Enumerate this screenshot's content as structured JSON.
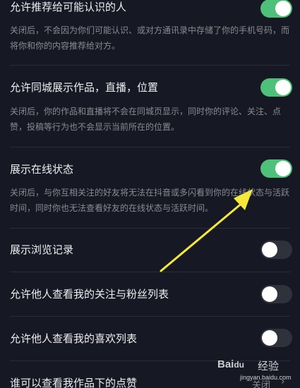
{
  "settings": [
    {
      "title": "允许推荐给可能认识的人",
      "description": "关闭后，不会因为你们可能认识、或对方通讯录中存储了你的手机号码，而将你和你的内容推荐给对方。",
      "toggle": "on"
    },
    {
      "title": "允许同城展示作品，直播，位置",
      "description": "关闭后，你的作品和直播将不会在同城页显示，同时你的评论、关注、点赞，投稿等行为也不会显示当前所在的位置。",
      "toggle": "on"
    },
    {
      "title": "展示在线状态",
      "description": "关闭后，与你互相关注的好友将无法在抖音或多闪看到你的在线状态与活跃时间，同时你也无法查看好友的在线状态与活跃时间。",
      "toggle": "on"
    },
    {
      "title": "展示浏览记录",
      "toggle": "off"
    },
    {
      "title": "允许他人查看我的关注与粉丝列表",
      "toggle": "off"
    },
    {
      "title": "允许他人查看我的喜欢列表",
      "toggle": "off"
    },
    {
      "title": "谁可以查看我作品下的点赞",
      "value": "关闭",
      "chevron": "›"
    }
  ],
  "watermark": {
    "brand": "Bai",
    "brand_paw": "du",
    "cn": "经验",
    "url": "jingyan.baidu.com"
  },
  "colors": {
    "background": "#161823",
    "toggle_on": "#4fc07a",
    "toggle_off": "#2f313b",
    "annotation_arrow": "#f5e83a"
  },
  "icons": {
    "annotation": "yellow-arrow-icon",
    "chevron": "chevron-right-icon"
  }
}
